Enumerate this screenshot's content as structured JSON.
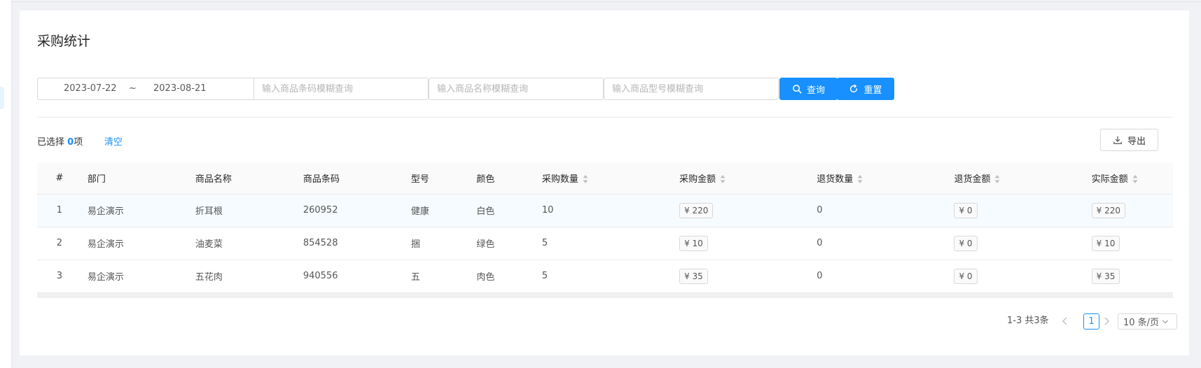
{
  "page": {
    "title": "采购统计"
  },
  "filters": {
    "date_start": "2023-07-22",
    "date_separator": "~",
    "date_end": "2023-08-21",
    "barcode_placeholder": "输入商品条码模糊查询",
    "name_placeholder": "输入商品名称模糊查询",
    "model_placeholder": "输入商品型号模糊查询",
    "search_label": "查询",
    "reset_label": "重置"
  },
  "toolbar": {
    "selected_prefix": "已选择 ",
    "selected_count": "0",
    "selected_suffix": "项",
    "clear_label": "清空",
    "export_label": "导出"
  },
  "table": {
    "columns": [
      "#",
      "部门",
      "商品名称",
      "商品条码",
      "型号",
      "颜色",
      "采购数量",
      "采购金额",
      "退货数量",
      "退货金额",
      "实际金额"
    ],
    "rows": [
      {
        "index": "1",
        "dept": "易企演示",
        "name": "折耳根",
        "barcode": "260952",
        "model": "健康",
        "color": "白色",
        "qty": "10",
        "amount": "¥ 220",
        "return_qty": "0",
        "return_amount": "¥ 0",
        "actual": "¥ 220"
      },
      {
        "index": "2",
        "dept": "易企演示",
        "name": "油麦菜",
        "barcode": "854528",
        "model": "捆",
        "color": "绿色",
        "qty": "5",
        "amount": "¥ 10",
        "return_qty": "0",
        "return_amount": "¥ 0",
        "actual": "¥ 10"
      },
      {
        "index": "3",
        "dept": "易企演示",
        "name": "五花肉",
        "barcode": "940556",
        "model": "五",
        "color": "肉色",
        "qty": "5",
        "amount": "¥ 35",
        "return_qty": "0",
        "return_amount": "¥ 0",
        "actual": "¥ 35"
      }
    ]
  },
  "pagination": {
    "total_text": "1-3 共3条",
    "current_page": "1",
    "page_size": "10 条/页"
  },
  "colors": {
    "primary": "#1890ff",
    "background": "#f0f2f5"
  }
}
